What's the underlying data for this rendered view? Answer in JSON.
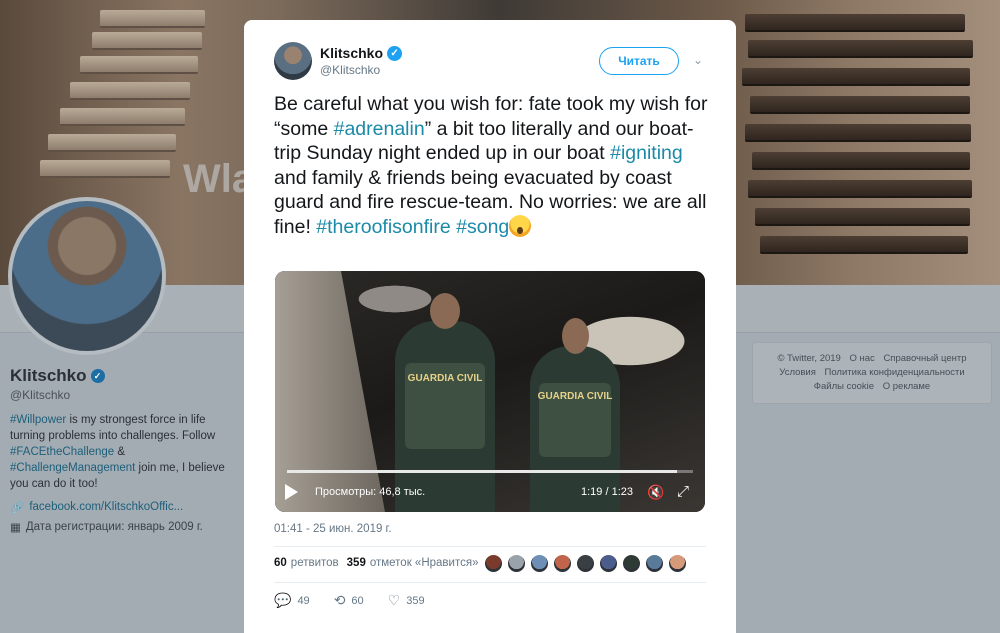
{
  "background_profile": {
    "banner_text": "Wla Klits Chal",
    "name": "Klitschko",
    "handle": "@Klitschko",
    "bio": [
      {
        "text": "#Willpower",
        "tag": true
      },
      {
        "text": " is my strongest force in life turning problems into challenges. Follow ",
        "tag": false
      },
      {
        "text": "#FACEtheChallenge",
        "tag": true
      },
      {
        "text": " & ",
        "tag": false
      },
      {
        "text": "#ChallengeManagement",
        "tag": true
      },
      {
        "text": " join me, I believe you can do it too!",
        "tag": false
      }
    ],
    "website": "facebook.com/KlitschkoOffic...",
    "joined": "Дата регистрации: январь 2009 г.",
    "footer_links": [
      "© Twitter, 2019",
      "О нас",
      "Справочный центр",
      "Условия",
      "Политика конфиденциальности",
      "Файлы cookie",
      "О рекламе"
    ]
  },
  "tweet": {
    "author_name": "Klitschko",
    "author_handle": "@Klitschko",
    "follow_label": "Читать",
    "text_parts": [
      {
        "text": "Be careful what you wish for: fate took my wish for “some ",
        "tag": false
      },
      {
        "text": "#adrenalin",
        "tag": true
      },
      {
        "text": "” a bit too literally and our boat-trip Sunday night ended up in our boat ",
        "tag": false
      },
      {
        "text": "#igniting",
        "tag": true
      },
      {
        "text": " and family & friends being evacuated by coast guard and fire rescue-team. No worries: we are all fine! ",
        "tag": false
      },
      {
        "text": "#theroofisonfire",
        "tag": true
      },
      {
        "text": " ",
        "tag": false
      },
      {
        "text": "#song",
        "tag": true
      }
    ],
    "emoji": "scream-emoji",
    "video": {
      "guard_label_1": "GUARDIA CIVIL",
      "guard_label_2": "GUARDIA CIVIL",
      "views": "Просмотры: 46,8 тыс.",
      "time": "1:19 / 1:23",
      "progress": 0.96
    },
    "timestamp": "01:41 - 25 июн. 2019 г.",
    "retweets_count": "60",
    "retweets_label": "ретвитов",
    "likes_count": "359",
    "likes_label": "отметок «Нравится»",
    "likers": [
      "#7a3b2c",
      "#9aa3ab",
      "#6d8fb5",
      "#c0654c",
      "#3a3f44",
      "#4b5d8c",
      "#2e3a34",
      "#5a7a9a",
      "#d69a7a"
    ],
    "actions": {
      "replies": "49",
      "retweets": "60",
      "likes": "359"
    }
  }
}
